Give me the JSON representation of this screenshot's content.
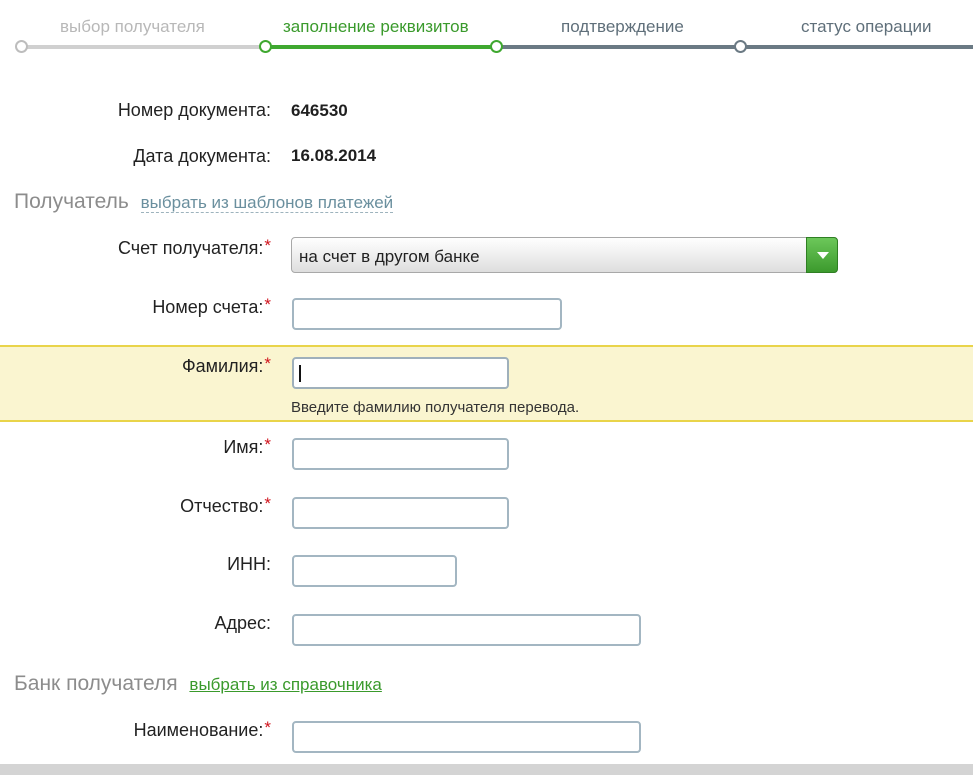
{
  "steps": [
    {
      "label": "выбор получателя",
      "state": "done"
    },
    {
      "label": "заполнение реквизитов",
      "state": "active"
    },
    {
      "label": "подтверждение",
      "state": "pending"
    },
    {
      "label": "статус операции",
      "state": "pending"
    }
  ],
  "document": {
    "number_label": "Номер документа:",
    "number_value": "646530",
    "date_label": "Дата документа:",
    "date_value": "16.08.2014"
  },
  "recipient": {
    "section_title": "Получатель",
    "templates_link": "выбрать из шаблонов платежей",
    "account_type_label": "Счет получателя:",
    "account_type_value": "на счет в другом банке",
    "account_number_label": "Номер счета:",
    "account_number_value": "",
    "surname_label": "Фамилия:",
    "surname_value": "",
    "surname_hint": "Введите фамилию получателя перевода.",
    "name_label": "Имя:",
    "name_value": "",
    "patronymic_label": "Отчество:",
    "patronymic_value": "",
    "inn_label": "ИНН:",
    "inn_value": "",
    "address_label": "Адрес:",
    "address_value": ""
  },
  "bank": {
    "section_title": "Банк получателя",
    "directory_link": "выбрать из справочника",
    "name_label": "Наименование:",
    "name_value": ""
  },
  "required_mark": "*",
  "colors": {
    "accent_green": "#3fa830",
    "required_red": "#d0121b",
    "highlight_bg": "#faf5d0"
  }
}
